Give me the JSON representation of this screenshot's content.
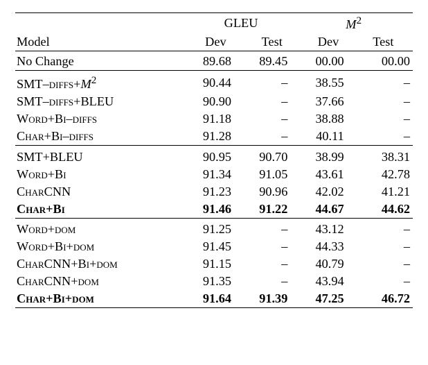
{
  "header": {
    "metric1": "GLEU",
    "metric2_a": "M",
    "metric2_b": "2",
    "model_label": "Model",
    "dev": "Dev",
    "test": "Test"
  },
  "groups": [
    {
      "rows": [
        {
          "name": "No Change",
          "sc": false,
          "gleu_dev": "89.68",
          "gleu_test": "89.45",
          "m2_dev": "00.00",
          "m2_test": "00.00",
          "bold": false
        }
      ]
    },
    {
      "rows": [
        {
          "name_pre": "SMT–",
          "name_sc": "diffs",
          "name_post": "+",
          "sup_m2": true,
          "name_tail": "",
          "gleu_dev": "90.44",
          "gleu_test": "–",
          "m2_dev": "38.55",
          "m2_test": "–"
        },
        {
          "name_pre": "SMT–",
          "name_sc": "diffs",
          "name_post": "+BLEU",
          "gleu_dev": "90.90",
          "gleu_test": "–",
          "m2_dev": "37.66",
          "m2_test": "–"
        },
        {
          "name_sc_full": "Word+Bi–diffs",
          "gleu_dev": "91.18",
          "gleu_test": "–",
          "m2_dev": "38.88",
          "m2_test": "–"
        },
        {
          "name_sc_full": "Char+Bi–diffs",
          "gleu_dev": "91.28",
          "gleu_test": "–",
          "m2_dev": "40.11",
          "m2_test": "–"
        }
      ]
    },
    {
      "rows": [
        {
          "name": "SMT+BLEU",
          "gleu_dev": "90.95",
          "gleu_test": "90.70",
          "m2_dev": "38.99",
          "m2_test": "38.31"
        },
        {
          "name_sc_full": "Word+Bi",
          "gleu_dev": "91.34",
          "gleu_test": "91.05",
          "m2_dev": "43.61",
          "m2_test": "42.78"
        },
        {
          "name_sc_full": "CharCNN",
          "gleu_dev": "91.23",
          "gleu_test": "90.96",
          "m2_dev": "42.02",
          "m2_test": "41.21"
        },
        {
          "name_sc_full": "Char+Bi",
          "gleu_dev": "91.46",
          "gleu_test": "91.22",
          "m2_dev": "44.67",
          "m2_test": "44.62",
          "bold": true
        }
      ]
    },
    {
      "rows": [
        {
          "name_sc_full": "Word+dom",
          "gleu_dev": "91.25",
          "gleu_test": "–",
          "m2_dev": "43.12",
          "m2_test": "–"
        },
        {
          "name_sc_full": "Word+Bi+dom",
          "gleu_dev": "91.45",
          "gleu_test": "–",
          "m2_dev": "44.33",
          "m2_test": "–"
        },
        {
          "name_sc_full": "CharCNN+Bi+dom",
          "gleu_dev": "91.15",
          "gleu_test": "–",
          "m2_dev": "40.79",
          "m2_test": "–"
        },
        {
          "name_sc_full": "CharCNN+dom",
          "gleu_dev": "91.35",
          "gleu_test": "–",
          "m2_dev": "43.94",
          "m2_test": "–"
        },
        {
          "name_sc_full": "Char+Bi+dom",
          "gleu_dev": "91.64",
          "gleu_test": "91.39",
          "m2_dev": "47.25",
          "m2_test": "46.72",
          "bold": true
        }
      ]
    }
  ],
  "chart_data": {
    "type": "table",
    "title": "Model comparison on GLEU and M² (Dev/Test)",
    "columns": [
      "Model",
      "GLEU Dev",
      "GLEU Test",
      "M² Dev",
      "M² Test"
    ],
    "rows": [
      [
        "No Change",
        89.68,
        89.45,
        0.0,
        0.0
      ],
      [
        "SMT–DIFFS+M²",
        90.44,
        null,
        38.55,
        null
      ],
      [
        "SMT–DIFFS+BLEU",
        90.9,
        null,
        37.66,
        null
      ],
      [
        "WORD+BI–DIFFS",
        91.18,
        null,
        38.88,
        null
      ],
      [
        "CHAR+BI–DIFFS",
        91.28,
        null,
        40.11,
        null
      ],
      [
        "SMT+BLEU",
        90.95,
        90.7,
        38.99,
        38.31
      ],
      [
        "WORD+BI",
        91.34,
        91.05,
        43.61,
        42.78
      ],
      [
        "CHARCNN",
        91.23,
        90.96,
        42.02,
        41.21
      ],
      [
        "CHAR+BI",
        91.46,
        91.22,
        44.67,
        44.62
      ],
      [
        "WORD+DOM",
        91.25,
        null,
        43.12,
        null
      ],
      [
        "WORD+BI+DOM",
        91.45,
        null,
        44.33,
        null
      ],
      [
        "CHARCNN+BI+DOM",
        91.15,
        null,
        40.79,
        null
      ],
      [
        "CHARCNN+DOM",
        91.35,
        null,
        43.94,
        null
      ],
      [
        "CHAR+BI+DOM",
        91.64,
        91.39,
        47.25,
        46.72
      ]
    ]
  }
}
